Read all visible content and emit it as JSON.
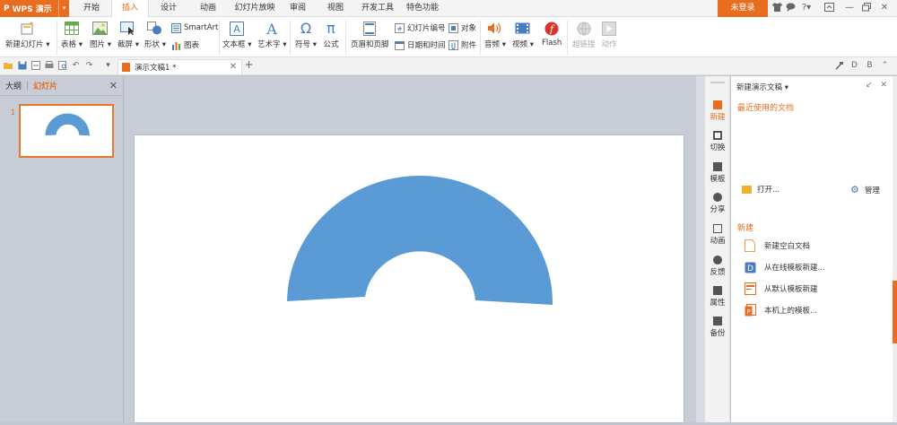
{
  "app": {
    "name": "WPS 演示",
    "logo": "P"
  },
  "menu_tabs": [
    {
      "label": "开始",
      "active": false
    },
    {
      "label": "插入",
      "active": true
    },
    {
      "label": "设计",
      "active": false
    },
    {
      "label": "动画",
      "active": false
    },
    {
      "label": "幻灯片放映",
      "active": false
    },
    {
      "label": "审阅",
      "active": false
    },
    {
      "label": "视图",
      "active": false
    },
    {
      "label": "开发工具",
      "active": false
    },
    {
      "label": "特色功能",
      "active": false
    }
  ],
  "login_label": "未登录",
  "ribbon": {
    "new_slide": "新建幻灯片",
    "table": "表格",
    "picture": "图片",
    "screenshot": "截屏",
    "shape": "形状",
    "smartart": "SmartArt",
    "chart": "图表",
    "textbox": "文本框",
    "wordart": "艺术字",
    "symbol": "符号",
    "formula": "公式",
    "header_footer": "页眉和页脚",
    "slide_number": "幻灯片编号",
    "date_time": "日期和时间",
    "object": "对象",
    "attachment": "附件",
    "audio": "音频",
    "video": "视频",
    "flash": "Flash",
    "hyperlink": "超链接",
    "action": "动作"
  },
  "document_tab": {
    "title": "演示文稿1 *"
  },
  "left_panel": {
    "outline_tab": "大纲",
    "slides_tab": "幻灯片",
    "slide_number": "1"
  },
  "sidebar": [
    {
      "label": "新建",
      "icon": "new-icon"
    },
    {
      "label": "切换",
      "icon": "switch-icon"
    },
    {
      "label": "模板",
      "icon": "template-icon"
    },
    {
      "label": "分享",
      "icon": "share-icon"
    },
    {
      "label": "动画",
      "icon": "animation-icon"
    },
    {
      "label": "反馈",
      "icon": "feedback-icon"
    },
    {
      "label": "属性",
      "icon": "properties-icon"
    },
    {
      "label": "备份",
      "icon": "backup-icon"
    }
  ],
  "right_panel": {
    "title": "新建演示文稿",
    "recent_heading": "最近使用的文档",
    "open_label": "打开...",
    "manage_label": "管理",
    "new_heading": "新建",
    "items": [
      {
        "label": "新建空白文档"
      },
      {
        "label": "从在线模板新建..."
      },
      {
        "label": "从默认模板新建"
      },
      {
        "label": "本机上的模板..."
      }
    ]
  },
  "colors": {
    "accent": "#e86d1f",
    "shape_fill": "#5b9bd5"
  }
}
